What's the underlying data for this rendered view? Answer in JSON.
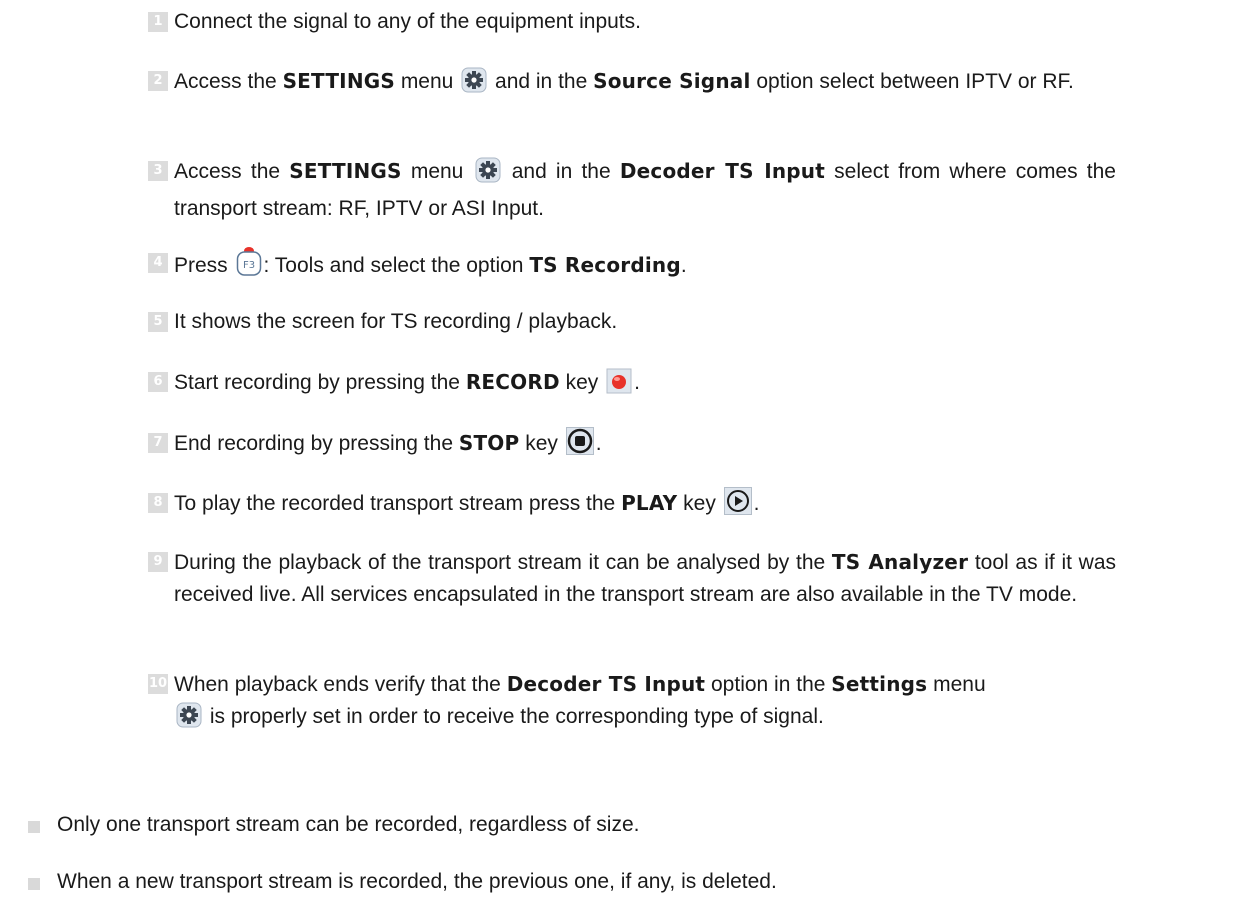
{
  "steps": [
    {
      "num": "1",
      "a": "Connect the signal to any of the equipment inputs."
    },
    {
      "num": "2",
      "a": "Access the ",
      "b1": "SETTINGS",
      "c": " menu ",
      "d": " and in the ",
      "b2": "Source Signal",
      "e": " option select between IPTV or RF."
    },
    {
      "num": "3",
      "a": "Access the ",
      "b1": "SETTINGS",
      "c": " menu ",
      "d": " and in the ",
      "b2": "Decoder TS Input",
      "e": " select from where comes the transport stream: RF, IPTV or ASI Input."
    },
    {
      "num": "4",
      "a": "Press ",
      "key": "F3",
      "c": ": Tools and select the option ",
      "b1": "TS Recording",
      "e": "."
    },
    {
      "num": "5",
      "a": "It shows the screen for TS recording / playback."
    },
    {
      "num": "6",
      "a": "Start recording by pressing the ",
      "b1": "RECORD",
      "c": " key ",
      "e": "."
    },
    {
      "num": "7",
      "a": "End recording by pressing the ",
      "b1": "STOP",
      "c": " key ",
      "e": "."
    },
    {
      "num": "8",
      "a": "To play the recorded transport stream press the ",
      "b1": "PLAY",
      "c": " key ",
      "e": "."
    },
    {
      "num": "9",
      "a": "During the playback of the transport stream it can be analysed by the ",
      "b1": "TS Analyzer",
      "e": " tool as if it was received live. All services encapsulated in the transport stream are also available in the TV mode."
    },
    {
      "num": "10",
      "a": "When playback ends verify that the ",
      "b1": "Decoder TS Input",
      "c": " option in the ",
      "b2": "Settings",
      "d": " menu ",
      "e": " is properly set in order to receive the corresponding type of signal."
    }
  ],
  "notes": [
    "Only one transport stream can be recorded, regardless of size.",
    "When a new transport stream is recorded, the previous one, if any, is deleted."
  ],
  "icons": {
    "settings": "gear-icon",
    "f3_key": "f3-key-icon",
    "record": "record-icon",
    "stop": "stop-icon",
    "play": "play-icon"
  }
}
